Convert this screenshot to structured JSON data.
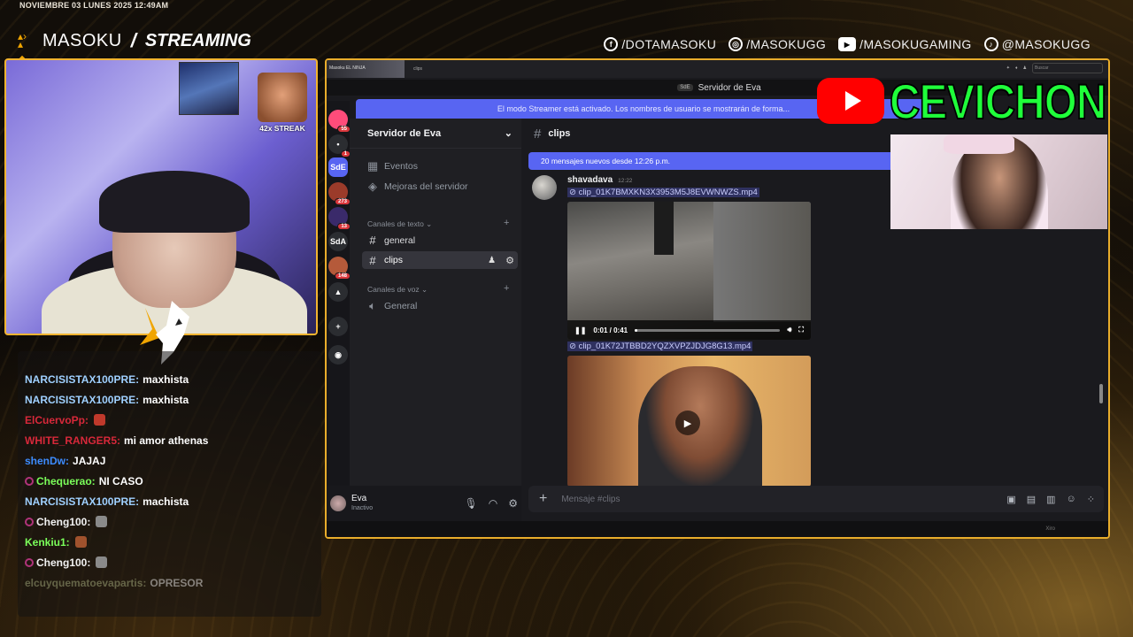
{
  "overlay": {
    "date": "NOVIEMBRE 03 LUNES 2025 12:49AM",
    "brand": {
      "name": "MASOKU",
      "slash": "/",
      "tag": "STREAMING"
    },
    "socials": [
      {
        "icon": "facebook-icon",
        "glyph": "f",
        "handle": "/DOTAMASOKU"
      },
      {
        "icon": "instagram-icon",
        "glyph": "◎",
        "handle": "/MASOKUGG"
      },
      {
        "icon": "youtube-icon",
        "glyph": "▶",
        "handle": "/MASOKUGAMING"
      },
      {
        "icon": "tiktok-icon",
        "glyph": "♪",
        "handle": "@MASOKUGG"
      }
    ],
    "streak": "42x STREAK",
    "accent": "#f2b430"
  },
  "chat": [
    {
      "user": "NARCISISTAX100PRE:",
      "color": "#9fd0ff",
      "msg": "maxhista",
      "badge": false,
      "emote": null
    },
    {
      "user": "NARCISISTAX100PRE:",
      "color": "#9fd0ff",
      "msg": "maxhista",
      "badge": false,
      "emote": null
    },
    {
      "user": "ElCuervoPp:",
      "color": "#d8283a",
      "msg": "",
      "badge": false,
      "emote": "#c0392b"
    },
    {
      "user": "WHITE_RANGER5:",
      "color": "#d8283a",
      "msg": "mi amor athenas",
      "badge": false,
      "emote": null
    },
    {
      "user": "shenDw:",
      "color": "#3d8cff",
      "msg": "JAJAJ",
      "badge": false,
      "emote": null
    },
    {
      "user": "Chequerao:",
      "color": "#7bff5a",
      "msg": "NI CASO",
      "badge": true,
      "emote": null
    },
    {
      "user": "NARCISISTAX100PRE:",
      "color": "#9fd0ff",
      "msg": "machista",
      "badge": false,
      "emote": null
    },
    {
      "user": "Cheng100:",
      "color": "#f2f2f2",
      "msg": "",
      "badge": true,
      "emote": "#8a8a8a"
    },
    {
      "user": "Kenkiu1:",
      "color": "#7bff5a",
      "msg": "",
      "badge": false,
      "emote": "#a0522d"
    },
    {
      "user": "Cheng100:",
      "color": "#f2f2f2",
      "msg": "",
      "badge": true,
      "emote": "#8a8a8a"
    },
    {
      "user": "elcuyquematoevapartis:",
      "color": "#b8c08c",
      "msg": "OPRESOR",
      "badge": false,
      "emote": null,
      "faded": true
    }
  ],
  "discord": {
    "obs_tab": "Masoku EL NINJA",
    "obs_tab2": "clips",
    "search_placeholder": "Buscar",
    "window_title": "Servidor de Eva",
    "server_tag": "SdE",
    "streamer_banner": "El modo Streamer está activado. Los nombres de usuario se mostrarán de forma...",
    "guilds": [
      {
        "label": "",
        "color": "#ff4c7a",
        "count": "55"
      },
      {
        "label": "•",
        "color": "#2b2d31",
        "count": "1"
      },
      {
        "label": "SdE",
        "color": "#5865f2",
        "count": ""
      },
      {
        "label": "",
        "color": "#9b3b2a",
        "count": "273"
      },
      {
        "label": "",
        "color": "#3a2a6a",
        "count": "13"
      },
      {
        "label": "SdA",
        "color": "#2b2d31",
        "count": ""
      },
      {
        "label": "",
        "color": "#b55a3a",
        "count": "148"
      },
      {
        "label": "▲",
        "color": "#2b2d31",
        "count": ""
      },
      {
        "label": "+",
        "color": "#2b2d31",
        "count": ""
      },
      {
        "label": "◉",
        "color": "#2b2d31",
        "count": ""
      }
    ],
    "server_name": "Servidor de Eva",
    "menu": [
      {
        "icon": "events-icon",
        "label": "Eventos"
      },
      {
        "icon": "boost-icon",
        "label": "Mejoras del servidor"
      }
    ],
    "text_category": "Canales de texto",
    "text_channels": [
      "general",
      "clips"
    ],
    "voice_category": "Canales de voz",
    "voice_channels": [
      "General"
    ],
    "user": {
      "name": "Eva",
      "status": "Inactivo"
    },
    "channel": "clips",
    "new_messages": "20 mensajes nuevos desde 12:26 p.m.",
    "message": {
      "author": "shavadava",
      "time": "12:22",
      "attachments": [
        {
          "name": "clip_01K7BMXKN3X3953M5J8EVWNWZS.mp4",
          "time": "0:01 / 0:41",
          "progress": 0.02
        },
        {
          "name": "clip_01K72JTBBD2YQZXVPZJDJG8G13.mp4"
        }
      ]
    },
    "composer_placeholder": "Mensaje #clips",
    "bottom_status": "Xiro"
  },
  "cevichon": {
    "title": "CEVICHON"
  }
}
